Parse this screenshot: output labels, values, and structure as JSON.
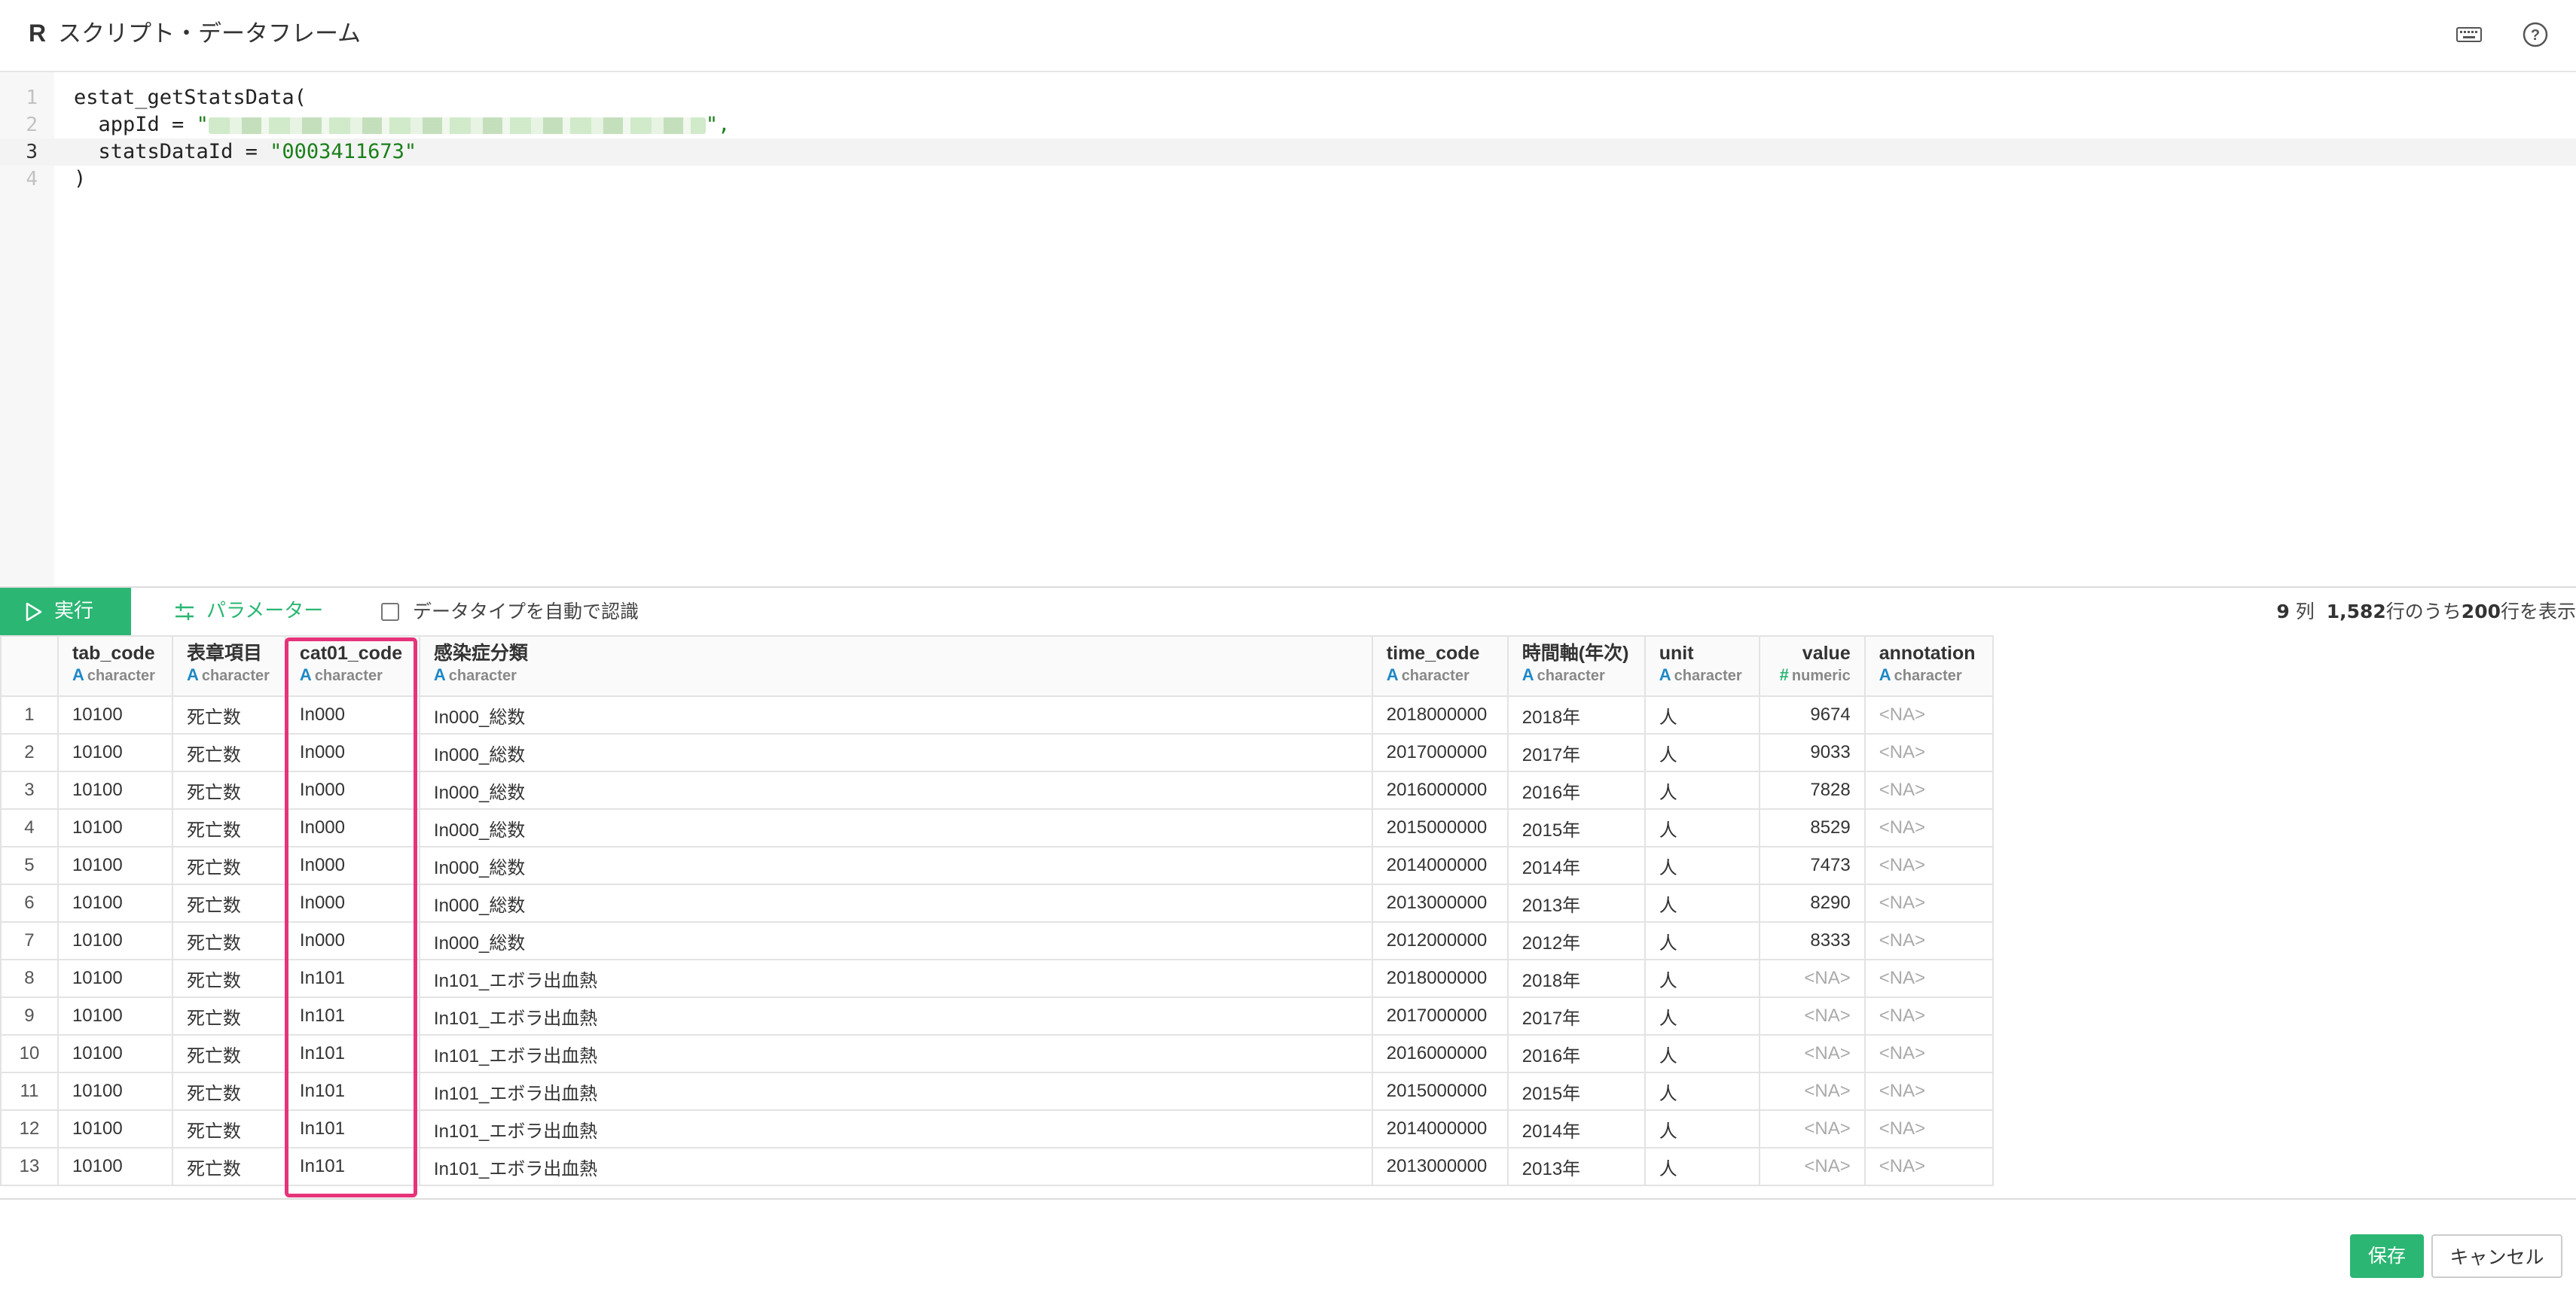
{
  "window": {
    "title_prefix": "R",
    "title": "スクリプト・データフレーム",
    "icons": [
      "keyboard-icon",
      "help-icon"
    ]
  },
  "editor": {
    "lines": [
      {
        "num": "1",
        "code": "estat_getStatsData("
      },
      {
        "num": "2",
        "code_prefix": "  appId = ",
        "string_open": "\"",
        "string_close": "\",",
        "masked": true
      },
      {
        "num": "3",
        "code_prefix": "  statsDataId = ",
        "string": "\"0003411673\"",
        "active": true
      },
      {
        "num": "4",
        "code": ")"
      }
    ]
  },
  "toolbar": {
    "run_label": "実行",
    "params_label": "パラメーター",
    "autotype_label": "データタイプを自動で認識",
    "autotype_checked": false,
    "cols_count": "9",
    "cols_unit": "列",
    "rows_total": "1,582",
    "rows_mid": "行のうち",
    "rows_shown": "200",
    "rows_tail": "行を表示"
  },
  "table": {
    "columns": [
      {
        "name": "tab_code",
        "type": "character",
        "type_icon": "A"
      },
      {
        "name": "表章項目",
        "type": "character",
        "type_icon": "A"
      },
      {
        "name": "cat01_code",
        "type": "character",
        "type_icon": "A"
      },
      {
        "name": "感染症分類",
        "type": "character",
        "type_icon": "A"
      },
      {
        "name": "time_code",
        "type": "character",
        "type_icon": "A"
      },
      {
        "name": "時間軸(年次)",
        "type": "character",
        "type_icon": "A"
      },
      {
        "name": "unit",
        "type": "character",
        "type_icon": "A"
      },
      {
        "name": "value",
        "type": "numeric",
        "type_icon": "#"
      },
      {
        "name": "annotation",
        "type": "character",
        "type_icon": "A"
      }
    ],
    "rows": [
      [
        "1",
        "10100",
        "死亡数",
        "In000",
        "In000_総数",
        "2018000000",
        "2018年",
        "人",
        "9674",
        "<NA>"
      ],
      [
        "2",
        "10100",
        "死亡数",
        "In000",
        "In000_総数",
        "2017000000",
        "2017年",
        "人",
        "9033",
        "<NA>"
      ],
      [
        "3",
        "10100",
        "死亡数",
        "In000",
        "In000_総数",
        "2016000000",
        "2016年",
        "人",
        "7828",
        "<NA>"
      ],
      [
        "4",
        "10100",
        "死亡数",
        "In000",
        "In000_総数",
        "2015000000",
        "2015年",
        "人",
        "8529",
        "<NA>"
      ],
      [
        "5",
        "10100",
        "死亡数",
        "In000",
        "In000_総数",
        "2014000000",
        "2014年",
        "人",
        "7473",
        "<NA>"
      ],
      [
        "6",
        "10100",
        "死亡数",
        "In000",
        "In000_総数",
        "2013000000",
        "2013年",
        "人",
        "8290",
        "<NA>"
      ],
      [
        "7",
        "10100",
        "死亡数",
        "In000",
        "In000_総数",
        "2012000000",
        "2012年",
        "人",
        "8333",
        "<NA>"
      ],
      [
        "8",
        "10100",
        "死亡数",
        "In101",
        "In101_エボラ出血熱",
        "2018000000",
        "2018年",
        "人",
        "<NA>",
        "<NA>"
      ],
      [
        "9",
        "10100",
        "死亡数",
        "In101",
        "In101_エボラ出血熱",
        "2017000000",
        "2017年",
        "人",
        "<NA>",
        "<NA>"
      ],
      [
        "10",
        "10100",
        "死亡数",
        "In101",
        "In101_エボラ出血熱",
        "2016000000",
        "2016年",
        "人",
        "<NA>",
        "<NA>"
      ],
      [
        "11",
        "10100",
        "死亡数",
        "In101",
        "In101_エボラ出血熱",
        "2015000000",
        "2015年",
        "人",
        "<NA>",
        "<NA>"
      ],
      [
        "12",
        "10100",
        "死亡数",
        "In101",
        "In101_エボラ出血熱",
        "2014000000",
        "2014年",
        "人",
        "<NA>",
        "<NA>"
      ],
      [
        "13",
        "10100",
        "死亡数",
        "In101",
        "In101_エボラ出血熱",
        "2013000000",
        "2013年",
        "人",
        "<NA>",
        "<NA>"
      ]
    ],
    "highlighted_column": "cat01_code"
  },
  "footer": {
    "save_label": "保存",
    "cancel_label": "キャンセル"
  },
  "colors": {
    "accent": "#2bb673",
    "highlight": "#e6337a",
    "string": "#1a7f1a",
    "type_icon": "#1e88c8"
  }
}
